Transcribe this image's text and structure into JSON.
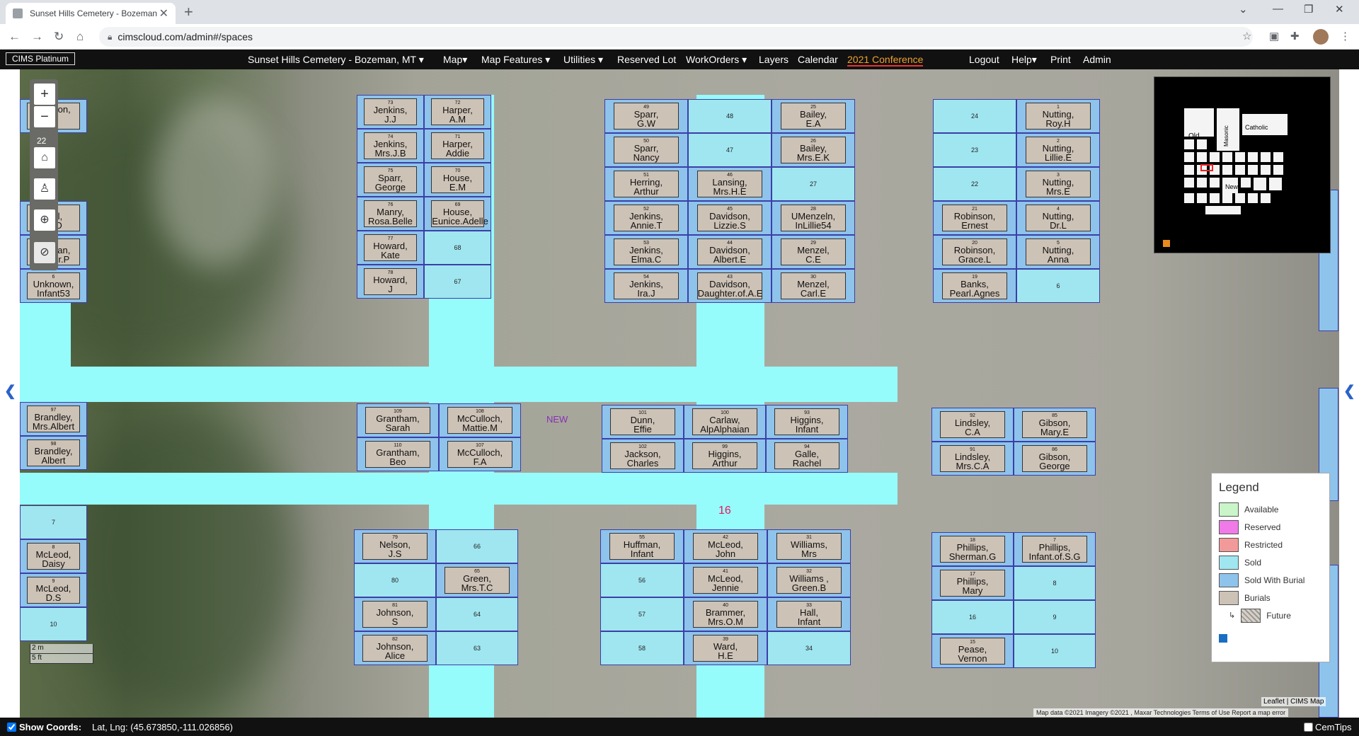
{
  "browser": {
    "tab_title": "Sunset Hills Cemetery - Bozeman",
    "url": "cimscloud.com/admin#/spaces"
  },
  "app": {
    "brand": "CIMS Platinum",
    "menu": [
      {
        "label": "Sunset Hills Cemetery - Bozeman, MT ▾"
      },
      {
        "label": "Map▾"
      },
      {
        "label": "Map Features ▾"
      },
      {
        "label": "Utilities ▾"
      },
      {
        "label": "Reserved Lot"
      },
      {
        "label": "WorkOrders ▾"
      },
      {
        "label": "Layers"
      },
      {
        "label": "Calendar"
      },
      {
        "label": "2021 Conference"
      }
    ],
    "right_menu": [
      {
        "label": "Logout"
      },
      {
        "label": "Help▾"
      },
      {
        "label": "Print"
      },
      {
        "label": "Admin"
      }
    ]
  },
  "map": {
    "zoom_level": "22",
    "section_label": "NEW",
    "block_label": "16",
    "scale_m": "2 m",
    "scale_ft": "5 ft",
    "minimap_labels": [
      "Old",
      "Catholic",
      "Masonic",
      "New"
    ],
    "lots": [
      {
        "num": "",
        "name": "Hodson,\nE"
      },
      {
        "num": "5",
        "name": "Bell,\nW.D"
      },
      {
        "num": "5",
        "name": "Morgan,\nOliver.P"
      },
      {
        "num": "6",
        "name": "Unknown,\nInfant53"
      },
      {
        "num": "97",
        "name": "Brandley,\nMrs.Albert"
      },
      {
        "num": "98",
        "name": "Brandley,\nAlbert"
      },
      {
        "num": "7",
        "name": ""
      },
      {
        "num": "8",
        "name": "McLeod,\nDaisy"
      },
      {
        "num": "9",
        "name": "McLeod,\nD.S"
      },
      {
        "num": "10",
        "name": ""
      },
      {
        "num": "73",
        "name": "Jenkins,\nJ.J"
      },
      {
        "num": "72",
        "name": "Harper,\nA.M"
      },
      {
        "num": "74",
        "name": "Jenkins,\nMrs.J.B"
      },
      {
        "num": "71",
        "name": "Harper,\nAddie"
      },
      {
        "num": "75",
        "name": "Sparr,\nGeorge"
      },
      {
        "num": "70",
        "name": "House,\nE.M"
      },
      {
        "num": "76",
        "name": "Manry,\nRosa.Belle"
      },
      {
        "num": "69",
        "name": "House,\nEunice.Adelle"
      },
      {
        "num": "77",
        "name": "Howard,\nKate"
      },
      {
        "num": "68",
        "name": ""
      },
      {
        "num": "78",
        "name": "Howard,\nJ"
      },
      {
        "num": "67",
        "name": ""
      },
      {
        "num": "49",
        "name": "Sparr,\nG.W"
      },
      {
        "num": "48",
        "name": ""
      },
      {
        "num": "25",
        "name": "Bailey,\nE.A"
      },
      {
        "num": "50",
        "name": "Sparr,\nNancy"
      },
      {
        "num": "47",
        "name": ""
      },
      {
        "num": "26",
        "name": "Bailey,\nMrs.E.K"
      },
      {
        "num": "51",
        "name": "Herring,\nArthur"
      },
      {
        "num": "46",
        "name": "Lansing,\nMrs.H.E"
      },
      {
        "num": "27",
        "name": ""
      },
      {
        "num": "52",
        "name": "Jenkins,\nAnnie.T"
      },
      {
        "num": "45",
        "name": "Davidson,\nLizzie.S"
      },
      {
        "num": "28",
        "name": "UMenzeln,\nInLillie54"
      },
      {
        "num": "53",
        "name": "Jenkins,\nElma.C"
      },
      {
        "num": "44",
        "name": "Davidson,\nAlbert.E"
      },
      {
        "num": "29",
        "name": "Menzel,\nC.E"
      },
      {
        "num": "54",
        "name": "Jenkins,\nIra.J"
      },
      {
        "num": "43",
        "name": "Davidson,\nDaughter.of.A.E"
      },
      {
        "num": "30",
        "name": "Menzel,\nCarl.E"
      },
      {
        "num": "24",
        "name": ""
      },
      {
        "num": "1",
        "name": "Nutting,\nRoy.H"
      },
      {
        "num": "23",
        "name": ""
      },
      {
        "num": "2",
        "name": "Nutting,\nLillie.E"
      },
      {
        "num": "22",
        "name": ""
      },
      {
        "num": "3",
        "name": "Nutting,\nMrs.E"
      },
      {
        "num": "21",
        "name": "Robinson,\nErnest"
      },
      {
        "num": "4",
        "name": "Nutting,\nDr.L"
      },
      {
        "num": "20",
        "name": "Robinson,\nGrace.L"
      },
      {
        "num": "5",
        "name": "Nutting,\nAnna"
      },
      {
        "num": "19",
        "name": "Banks,\nPearl.Agnes"
      },
      {
        "num": "6",
        "name": ""
      },
      {
        "num": "109",
        "name": "Grantham,\nSarah"
      },
      {
        "num": "108",
        "name": "McCulloch,\nMattie.M"
      },
      {
        "num": "110",
        "name": "Grantham,\nBeo"
      },
      {
        "num": "107",
        "name": "McCulloch,\nF.A"
      },
      {
        "num": "101",
        "name": "Dunn,\nEffie"
      },
      {
        "num": "100",
        "name": "Carlaw,\nAlpAlphaian"
      },
      {
        "num": "93",
        "name": "Higgins,\nInfant"
      },
      {
        "num": "102",
        "name": "Jackson,\nCharles"
      },
      {
        "num": "99",
        "name": "Higgins,\nArthur"
      },
      {
        "num": "94",
        "name": "Galle,\nRachel"
      },
      {
        "num": "92",
        "name": "Lindsley,\nC.A"
      },
      {
        "num": "85",
        "name": "Gibson,\nMary.E"
      },
      {
        "num": "91",
        "name": "Lindsley,\nMrs.C.A"
      },
      {
        "num": "86",
        "name": "Gibson,\nGeorge"
      },
      {
        "num": "79",
        "name": "Nelson,\nJ.S"
      },
      {
        "num": "66",
        "name": ""
      },
      {
        "num": "80",
        "name": ""
      },
      {
        "num": "65",
        "name": "Green,\nMrs.T.C"
      },
      {
        "num": "81",
        "name": "Johnson,\nS"
      },
      {
        "num": "64",
        "name": ""
      },
      {
        "num": "82",
        "name": "Johnson,\nAlice"
      },
      {
        "num": "63",
        "name": ""
      },
      {
        "num": "55",
        "name": "Huffman,\nInfant"
      },
      {
        "num": "42",
        "name": "McLeod,\nJohn"
      },
      {
        "num": "31",
        "name": "Williams,\nMrs"
      },
      {
        "num": "56",
        "name": ""
      },
      {
        "num": "41",
        "name": "McLeod,\nJennie"
      },
      {
        "num": "32",
        "name": "Williams ,\nGreen.B"
      },
      {
        "num": "57",
        "name": ""
      },
      {
        "num": "40",
        "name": "Brammer,\nMrs.O.M"
      },
      {
        "num": "33",
        "name": "Hall,\nInfant"
      },
      {
        "num": "58",
        "name": ""
      },
      {
        "num": "39",
        "name": "Ward,\nH.E"
      },
      {
        "num": "34",
        "name": ""
      },
      {
        "num": "18",
        "name": "Phillips,\nSherman.G"
      },
      {
        "num": "7",
        "name": "Phillips,\nInfant.of.S.G"
      },
      {
        "num": "17",
        "name": "Phillips,\nMary"
      },
      {
        "num": "8",
        "name": ""
      },
      {
        "num": "16",
        "name": ""
      },
      {
        "num": "9",
        "name": ""
      },
      {
        "num": "15",
        "name": "Pease,\nVernon"
      },
      {
        "num": "10",
        "name": ""
      }
    ]
  },
  "legend": {
    "title": "Legend",
    "items": [
      {
        "label": "Available",
        "color": "#c9f5c9"
      },
      {
        "label": "Reserved",
        "color": "#f07ae8"
      },
      {
        "label": "Restricted",
        "color": "#f29a9a"
      },
      {
        "label": "Sold",
        "color": "#a0e6f0"
      },
      {
        "label": "Sold With Burial",
        "color": "#8ec3ec"
      },
      {
        "label": "Burials",
        "color": "#cdc2b6"
      },
      {
        "label": "Future",
        "color": "#c0b8a8"
      }
    ]
  },
  "attribution": {
    "leaflet": "Leaflet | CIMS Map",
    "text": "Map data ©2021 Imagery ©2021 , Maxar Technologies   Terms of Use   Report a map error"
  },
  "status": {
    "show_coords_label": "Show Coords:",
    "coords": "Lat, Lng: (45.673850,-111.026856)",
    "cemtips_label": "CemTips"
  }
}
